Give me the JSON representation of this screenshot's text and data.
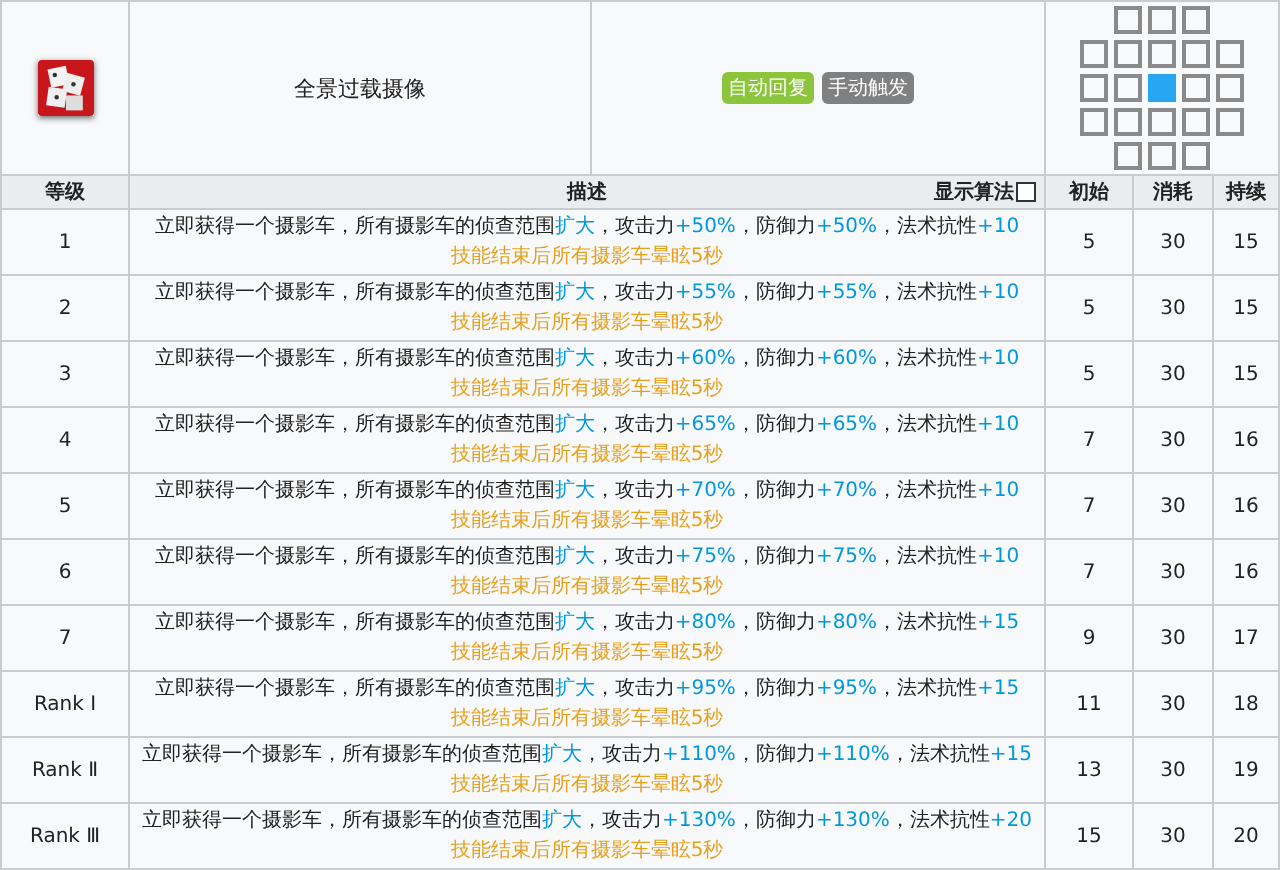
{
  "skill": {
    "name": "全景过载摄像",
    "tags": [
      {
        "label": "自动回复",
        "color": "#8cc43c"
      },
      {
        "label": "手动触发",
        "color": "#808080"
      }
    ],
    "range": [
      {
        "cells": [
          {
            "kind": "empty"
          },
          {
            "kind": "tile"
          },
          {
            "kind": "tile"
          },
          {
            "kind": "tile"
          },
          {
            "kind": "empty"
          }
        ]
      },
      {
        "cells": [
          {
            "kind": "tile"
          },
          {
            "kind": "tile"
          },
          {
            "kind": "tile"
          },
          {
            "kind": "tile"
          },
          {
            "kind": "tile"
          }
        ]
      },
      {
        "cells": [
          {
            "kind": "tile"
          },
          {
            "kind": "tile"
          },
          {
            "kind": "self"
          },
          {
            "kind": "tile"
          },
          {
            "kind": "tile"
          }
        ]
      },
      {
        "cells": [
          {
            "kind": "tile"
          },
          {
            "kind": "tile"
          },
          {
            "kind": "tile"
          },
          {
            "kind": "tile"
          },
          {
            "kind": "tile"
          }
        ]
      },
      {
        "cells": [
          {
            "kind": "empty"
          },
          {
            "kind": "tile"
          },
          {
            "kind": "tile"
          },
          {
            "kind": "tile"
          },
          {
            "kind": "empty"
          }
        ]
      }
    ]
  },
  "columns": {
    "level": "等级",
    "description": "描述",
    "formula_toggle": {
      "label": "显示算法",
      "checked": false
    },
    "initial": "初始",
    "cost": "消耗",
    "duration": "持续"
  },
  "rows": [
    {
      "level": "1",
      "parts": [
        {
          "text": "立即获得一个摄影车，所有摄影车的侦查范围",
          "highlight": false
        },
        {
          "text": "扩大",
          "highlight": true
        },
        {
          "text": "，攻击力",
          "highlight": false
        },
        {
          "text": "+50%",
          "highlight": true
        },
        {
          "text": "，防御力",
          "highlight": false
        },
        {
          "text": "+50%",
          "highlight": true
        },
        {
          "text": "，法术抗性",
          "highlight": false
        },
        {
          "text": "+10",
          "highlight": true
        }
      ],
      "note": "技能结束后所有摄影车晕眩5秒",
      "initial": "5",
      "cost": "30",
      "duration": "15"
    },
    {
      "level": "2",
      "parts": [
        {
          "text": "立即获得一个摄影车，所有摄影车的侦查范围",
          "highlight": false
        },
        {
          "text": "扩大",
          "highlight": true
        },
        {
          "text": "，攻击力",
          "highlight": false
        },
        {
          "text": "+55%",
          "highlight": true
        },
        {
          "text": "，防御力",
          "highlight": false
        },
        {
          "text": "+55%",
          "highlight": true
        },
        {
          "text": "，法术抗性",
          "highlight": false
        },
        {
          "text": "+10",
          "highlight": true
        }
      ],
      "note": "技能结束后所有摄影车晕眩5秒",
      "initial": "5",
      "cost": "30",
      "duration": "15"
    },
    {
      "level": "3",
      "parts": [
        {
          "text": "立即获得一个摄影车，所有摄影车的侦查范围",
          "highlight": false
        },
        {
          "text": "扩大",
          "highlight": true
        },
        {
          "text": "，攻击力",
          "highlight": false
        },
        {
          "text": "+60%",
          "highlight": true
        },
        {
          "text": "，防御力",
          "highlight": false
        },
        {
          "text": "+60%",
          "highlight": true
        },
        {
          "text": "，法术抗性",
          "highlight": false
        },
        {
          "text": "+10",
          "highlight": true
        }
      ],
      "note": "技能结束后所有摄影车晕眩5秒",
      "initial": "5",
      "cost": "30",
      "duration": "15"
    },
    {
      "level": "4",
      "parts": [
        {
          "text": "立即获得一个摄影车，所有摄影车的侦查范围",
          "highlight": false
        },
        {
          "text": "扩大",
          "highlight": true
        },
        {
          "text": "，攻击力",
          "highlight": false
        },
        {
          "text": "+65%",
          "highlight": true
        },
        {
          "text": "，防御力",
          "highlight": false
        },
        {
          "text": "+65%",
          "highlight": true
        },
        {
          "text": "，法术抗性",
          "highlight": false
        },
        {
          "text": "+10",
          "highlight": true
        }
      ],
      "note": "技能结束后所有摄影车晕眩5秒",
      "initial": "7",
      "cost": "30",
      "duration": "16"
    },
    {
      "level": "5",
      "parts": [
        {
          "text": "立即获得一个摄影车，所有摄影车的侦查范围",
          "highlight": false
        },
        {
          "text": "扩大",
          "highlight": true
        },
        {
          "text": "，攻击力",
          "highlight": false
        },
        {
          "text": "+70%",
          "highlight": true
        },
        {
          "text": "，防御力",
          "highlight": false
        },
        {
          "text": "+70%",
          "highlight": true
        },
        {
          "text": "，法术抗性",
          "highlight": false
        },
        {
          "text": "+10",
          "highlight": true
        }
      ],
      "note": "技能结束后所有摄影车晕眩5秒",
      "initial": "7",
      "cost": "30",
      "duration": "16"
    },
    {
      "level": "6",
      "parts": [
        {
          "text": "立即获得一个摄影车，所有摄影车的侦查范围",
          "highlight": false
        },
        {
          "text": "扩大",
          "highlight": true
        },
        {
          "text": "，攻击力",
          "highlight": false
        },
        {
          "text": "+75%",
          "highlight": true
        },
        {
          "text": "，防御力",
          "highlight": false
        },
        {
          "text": "+75%",
          "highlight": true
        },
        {
          "text": "，法术抗性",
          "highlight": false
        },
        {
          "text": "+10",
          "highlight": true
        }
      ],
      "note": "技能结束后所有摄影车晕眩5秒",
      "initial": "7",
      "cost": "30",
      "duration": "16"
    },
    {
      "level": "7",
      "parts": [
        {
          "text": "立即获得一个摄影车，所有摄影车的侦查范围",
          "highlight": false
        },
        {
          "text": "扩大",
          "highlight": true
        },
        {
          "text": "，攻击力",
          "highlight": false
        },
        {
          "text": "+80%",
          "highlight": true
        },
        {
          "text": "，防御力",
          "highlight": false
        },
        {
          "text": "+80%",
          "highlight": true
        },
        {
          "text": "，法术抗性",
          "highlight": false
        },
        {
          "text": "+15",
          "highlight": true
        }
      ],
      "note": "技能结束后所有摄影车晕眩5秒",
      "initial": "9",
      "cost": "30",
      "duration": "17"
    },
    {
      "level": "Rank Ⅰ",
      "parts": [
        {
          "text": "立即获得一个摄影车，所有摄影车的侦查范围",
          "highlight": false
        },
        {
          "text": "扩大",
          "highlight": true
        },
        {
          "text": "，攻击力",
          "highlight": false
        },
        {
          "text": "+95%",
          "highlight": true
        },
        {
          "text": "，防御力",
          "highlight": false
        },
        {
          "text": "+95%",
          "highlight": true
        },
        {
          "text": "，法术抗性",
          "highlight": false
        },
        {
          "text": "+15",
          "highlight": true
        }
      ],
      "note": "技能结束后所有摄影车晕眩5秒",
      "initial": "11",
      "cost": "30",
      "duration": "18"
    },
    {
      "level": "Rank Ⅱ",
      "parts": [
        {
          "text": "立即获得一个摄影车，所有摄影车的侦查范围",
          "highlight": false
        },
        {
          "text": "扩大",
          "highlight": true
        },
        {
          "text": "，攻击力",
          "highlight": false
        },
        {
          "text": "+110%",
          "highlight": true
        },
        {
          "text": "，防御力",
          "highlight": false
        },
        {
          "text": "+110%",
          "highlight": true
        },
        {
          "text": "，法术抗性",
          "highlight": false
        },
        {
          "text": "+15",
          "highlight": true
        }
      ],
      "note": "技能结束后所有摄影车晕眩5秒",
      "initial": "13",
      "cost": "30",
      "duration": "19"
    },
    {
      "level": "Rank Ⅲ",
      "parts": [
        {
          "text": "立即获得一个摄影车，所有摄影车的侦查范围",
          "highlight": false
        },
        {
          "text": "扩大",
          "highlight": true
        },
        {
          "text": "，攻击力",
          "highlight": false
        },
        {
          "text": "+130%",
          "highlight": true
        },
        {
          "text": "，防御力",
          "highlight": false
        },
        {
          "text": "+130%",
          "highlight": true
        },
        {
          "text": "，法术抗性",
          "highlight": false
        },
        {
          "text": "+20",
          "highlight": true
        }
      ],
      "note": "技能结束后所有摄影车晕眩5秒",
      "initial": "15",
      "cost": "30",
      "duration": "20"
    }
  ]
}
